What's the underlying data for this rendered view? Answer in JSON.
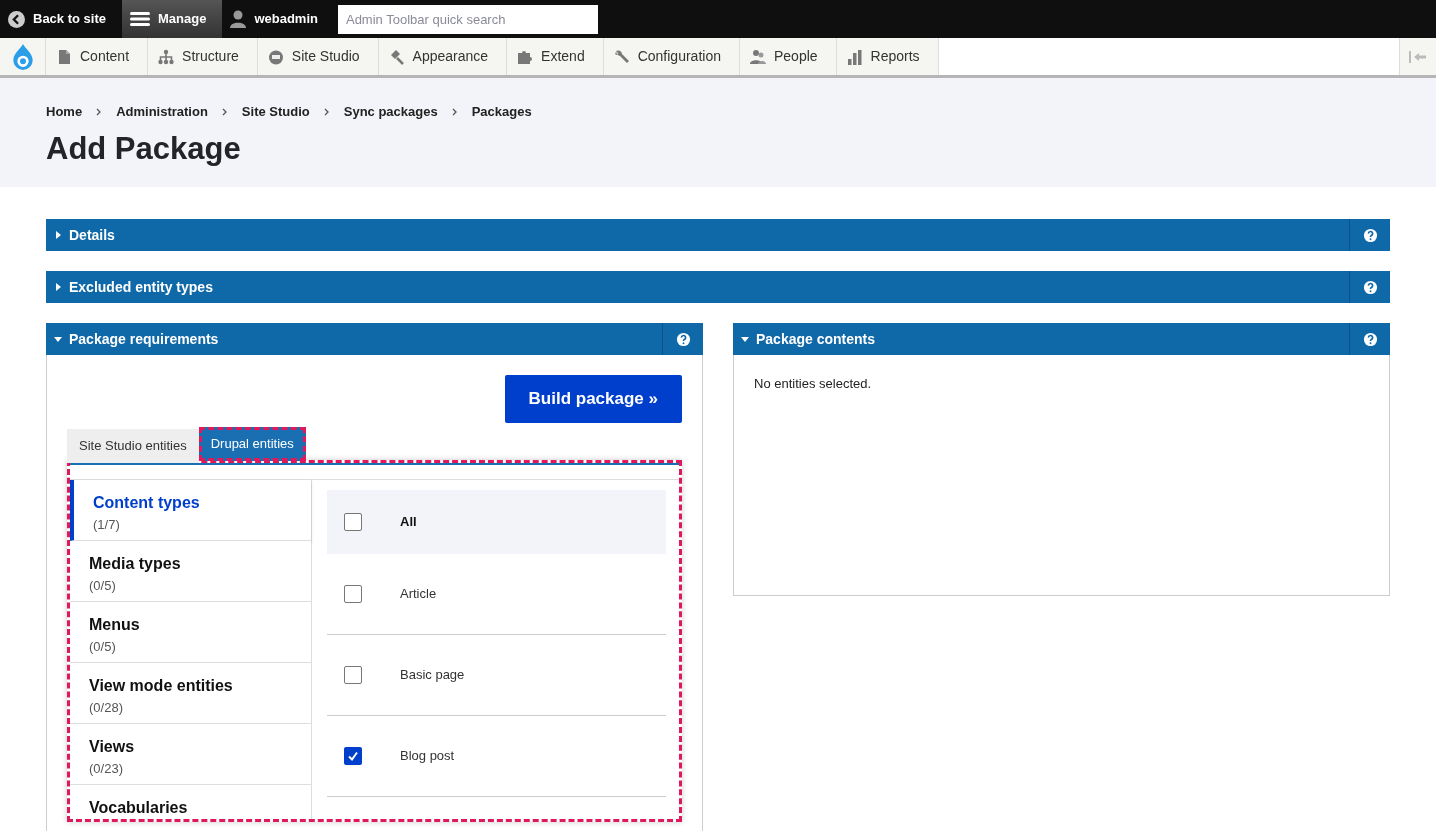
{
  "toolbar": {
    "back": "Back to site",
    "manage": "Manage",
    "user": "webadmin",
    "search": {
      "placeholder": "Admin Toolbar quick search"
    }
  },
  "menu": [
    {
      "label": "Content"
    },
    {
      "label": "Structure"
    },
    {
      "label": "Site Studio"
    },
    {
      "label": "Appearance"
    },
    {
      "label": "Extend"
    },
    {
      "label": "Configuration"
    },
    {
      "label": "People"
    },
    {
      "label": "Reports"
    }
  ],
  "breadcrumb": [
    "Home",
    "Administration",
    "Site Studio",
    "Sync packages",
    "Packages"
  ],
  "title": "Add Package",
  "sections": [
    {
      "title": "Details",
      "expanded": false
    },
    {
      "title": "Excluded entity types",
      "expanded": false
    }
  ],
  "requirements": {
    "title": "Package requirements",
    "expanded": true,
    "button": "Build package »",
    "tabs": [
      {
        "label": "Site Studio entities",
        "selected": false
      },
      {
        "label": "Drupal entities",
        "selected": true
      }
    ],
    "categories": [
      {
        "name": "Content types",
        "count": "(1/7)",
        "selected": true
      },
      {
        "name": "Media types",
        "count": "(0/5)",
        "selected": false
      },
      {
        "name": "Menus",
        "count": "(0/5)",
        "selected": false
      },
      {
        "name": "View mode entities",
        "count": "(0/28)",
        "selected": false
      },
      {
        "name": "Views",
        "count": "(0/23)",
        "selected": false
      },
      {
        "name": "Vocabularies",
        "selected": false
      }
    ],
    "items": [
      {
        "label": "All",
        "checked": false,
        "kind": "all"
      },
      {
        "label": "Article",
        "checked": false,
        "kind": "item"
      },
      {
        "label": "Basic page",
        "checked": false,
        "kind": "item"
      },
      {
        "label": "Blog post",
        "checked": true,
        "kind": "item"
      }
    ]
  },
  "contents": {
    "title": "Package contents",
    "expanded": true,
    "empty": "No entities selected."
  }
}
